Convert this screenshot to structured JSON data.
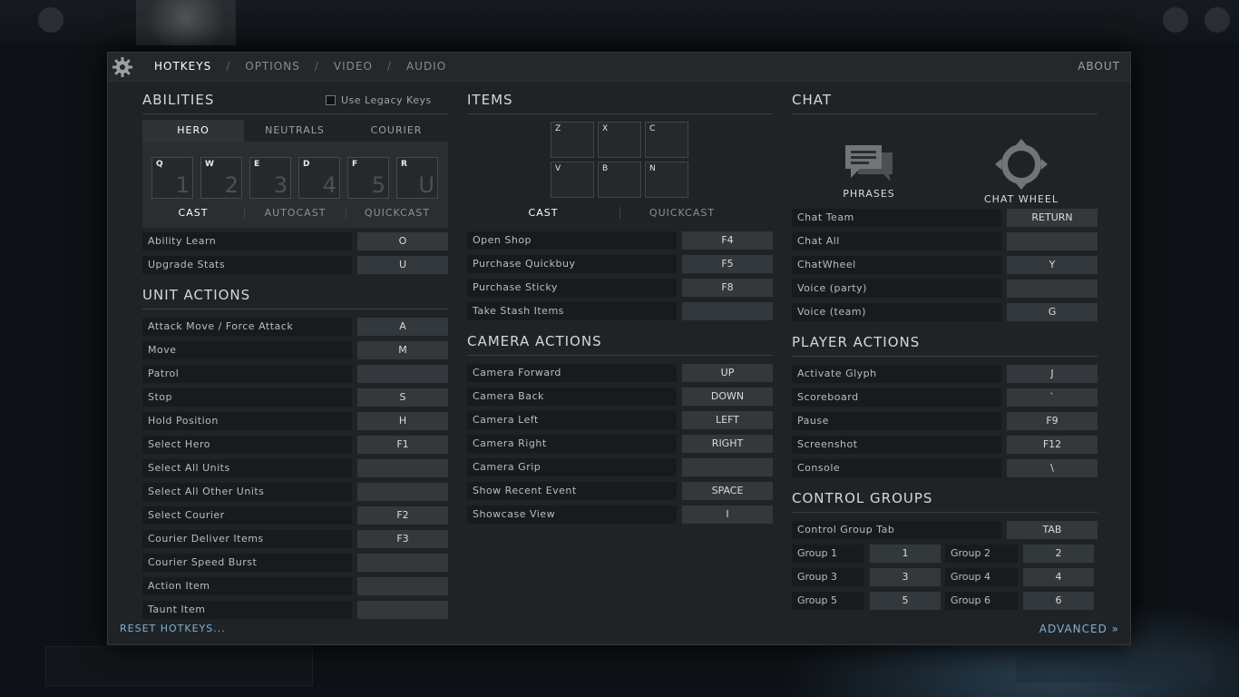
{
  "header": {
    "tabs": [
      {
        "label": "HOTKEYS",
        "active": true
      },
      {
        "label": "OPTIONS",
        "active": false
      },
      {
        "label": "VIDEO",
        "active": false
      },
      {
        "label": "AUDIO",
        "active": false
      }
    ],
    "separator": "/",
    "about_label": "ABOUT",
    "gear_icon": "gear-icon"
  },
  "abilities": {
    "title": "ABILITIES",
    "legacy_label": "Use Legacy Keys",
    "legacy_checked": false,
    "tabs": [
      "HERO",
      "NEUTRALS",
      "COURIER"
    ],
    "slots": [
      {
        "key": "Q",
        "num": "1"
      },
      {
        "key": "W",
        "num": "2"
      },
      {
        "key": "E",
        "num": "3"
      },
      {
        "key": "D",
        "num": "4"
      },
      {
        "key": "F",
        "num": "5"
      },
      {
        "key": "R",
        "num": "U"
      }
    ],
    "modes": [
      "CAST",
      "AUTOCAST",
      "QUICKCAST"
    ],
    "rows": [
      {
        "label": "Ability Learn",
        "key": "O"
      },
      {
        "label": "Upgrade Stats",
        "key": "U"
      }
    ]
  },
  "unit_actions": {
    "title": "UNIT ACTIONS",
    "rows": [
      {
        "label": "Attack Move / Force Attack",
        "key": "A"
      },
      {
        "label": "Move",
        "key": "M"
      },
      {
        "label": "Patrol",
        "key": ""
      },
      {
        "label": "Stop",
        "key": "S"
      },
      {
        "label": "Hold Position",
        "key": "H"
      },
      {
        "label": "Select Hero",
        "key": "F1"
      },
      {
        "label": "Select All Units",
        "key": ""
      },
      {
        "label": "Select All Other Units",
        "key": ""
      },
      {
        "label": "Select Courier",
        "key": "F2"
      },
      {
        "label": "Courier Deliver Items",
        "key": "F3"
      },
      {
        "label": "Courier Speed Burst",
        "key": ""
      },
      {
        "label": "Action Item",
        "key": ""
      },
      {
        "label": "Taunt Item",
        "key": ""
      }
    ]
  },
  "items": {
    "title": "ITEMS",
    "slots": [
      "Z",
      "X",
      "C",
      "V",
      "B",
      "N"
    ],
    "modes": [
      "CAST",
      "QUICKCAST"
    ],
    "rows": [
      {
        "label": "Open Shop",
        "key": "F4"
      },
      {
        "label": "Purchase Quickbuy",
        "key": "F5"
      },
      {
        "label": "Purchase Sticky",
        "key": "F8"
      },
      {
        "label": "Take Stash Items",
        "key": ""
      }
    ]
  },
  "camera_actions": {
    "title": "CAMERA ACTIONS",
    "rows": [
      {
        "label": "Camera Forward",
        "key": "UP"
      },
      {
        "label": "Camera Back",
        "key": "DOWN"
      },
      {
        "label": "Camera Left",
        "key": "LEFT"
      },
      {
        "label": "Camera Right",
        "key": "RIGHT"
      },
      {
        "label": "Camera Grip",
        "key": ""
      },
      {
        "label": "Show Recent Event",
        "key": "SPACE"
      },
      {
        "label": "Showcase View",
        "key": "I"
      }
    ]
  },
  "chat": {
    "title": "CHAT",
    "phrases_label": "PHRASES",
    "chatwheel_label": "CHAT WHEEL",
    "rows": [
      {
        "label": "Chat Team",
        "key": "RETURN"
      },
      {
        "label": "Chat All",
        "key": ""
      },
      {
        "label": "ChatWheel",
        "key": "Y"
      },
      {
        "label": "Voice (party)",
        "key": ""
      },
      {
        "label": "Voice (team)",
        "key": "G"
      }
    ]
  },
  "player_actions": {
    "title": "PLAYER ACTIONS",
    "rows": [
      {
        "label": "Activate Glyph",
        "key": "J"
      },
      {
        "label": "Scoreboard",
        "key": "`"
      },
      {
        "label": "Pause",
        "key": "F9"
      },
      {
        "label": "Screenshot",
        "key": "F12"
      },
      {
        "label": "Console",
        "key": "\\"
      }
    ]
  },
  "control_groups": {
    "title": "CONTROL GROUPS",
    "tab_row": {
      "label": "Control Group Tab",
      "key": "TAB"
    },
    "groups": [
      {
        "label": "Group 1",
        "key": "1"
      },
      {
        "label": "Group 2",
        "key": "2"
      },
      {
        "label": "Group 3",
        "key": "3"
      },
      {
        "label": "Group 4",
        "key": "4"
      },
      {
        "label": "Group 5",
        "key": "5"
      },
      {
        "label": "Group 6",
        "key": "6"
      }
    ]
  },
  "footer": {
    "reset_label": "RESET HOTKEYS...",
    "advanced_label": "ADVANCED »"
  },
  "colors": {
    "panel": "#1f2326",
    "key_bg": "#33383c",
    "label_bg": "#181b1d",
    "link": "#7fb0d4"
  }
}
